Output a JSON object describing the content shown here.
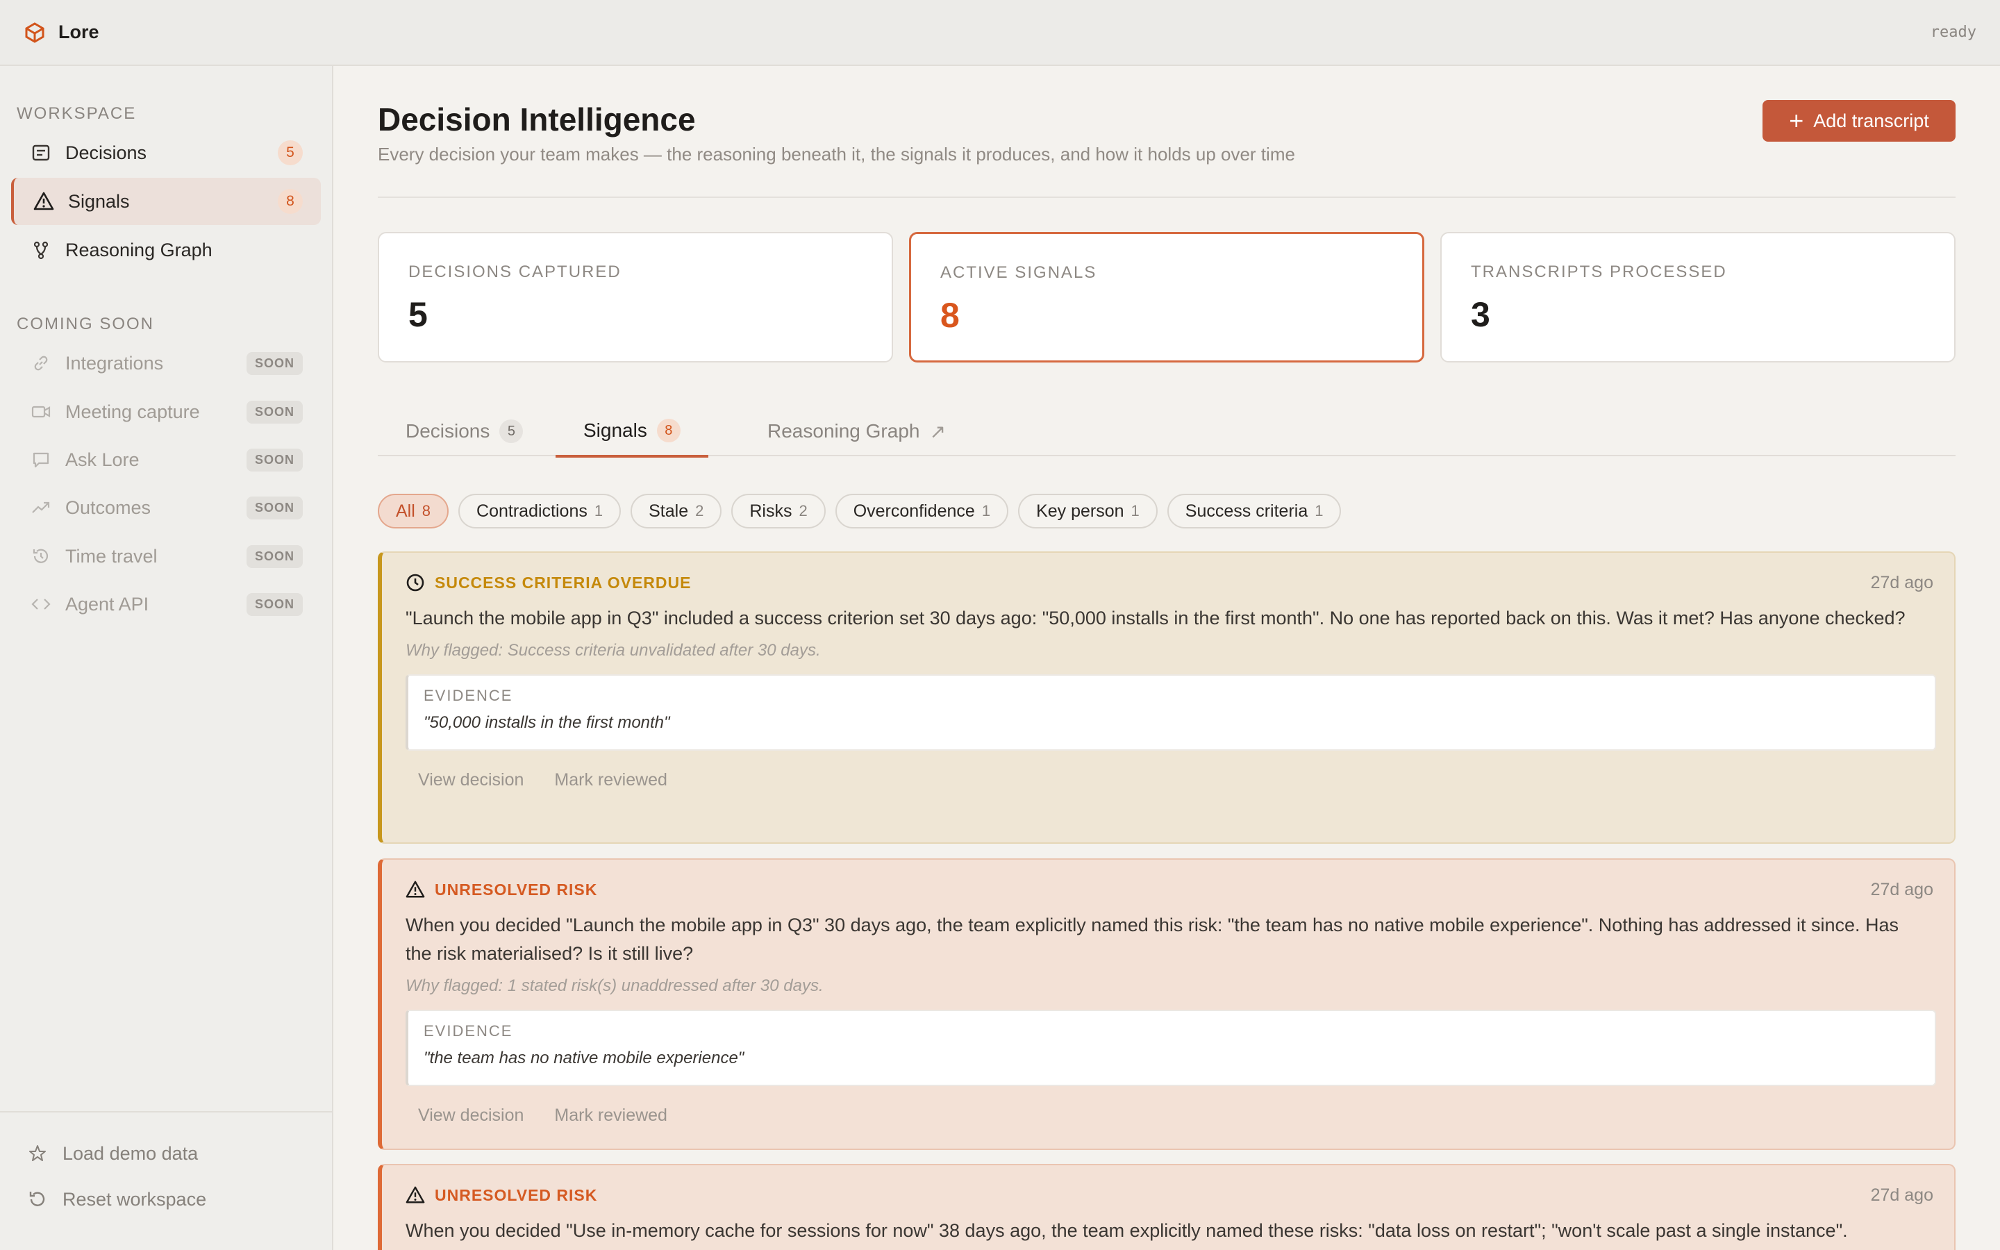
{
  "app": {
    "name": "Lore",
    "status": "ready"
  },
  "sidebar": {
    "workspace_label": "WORKSPACE",
    "items": [
      {
        "label": "Decisions",
        "count": "5",
        "icon": "list-icon"
      },
      {
        "label": "Signals",
        "count": "8",
        "icon": "warning-icon"
      },
      {
        "label": "Reasoning Graph",
        "icon": "branch-icon"
      }
    ],
    "coming_soon_label": "COMING SOON",
    "soon_items": [
      {
        "label": "Integrations",
        "badge": "SOON",
        "icon": "link-icon"
      },
      {
        "label": "Meeting capture",
        "badge": "SOON",
        "icon": "video-icon"
      },
      {
        "label": "Ask Lore",
        "badge": "SOON",
        "icon": "chat-icon"
      },
      {
        "label": "Outcomes",
        "badge": "SOON",
        "icon": "trend-icon"
      },
      {
        "label": "Time travel",
        "badge": "SOON",
        "icon": "history-icon"
      },
      {
        "label": "Agent API",
        "badge": "SOON",
        "icon": "code-icon"
      }
    ],
    "footer": [
      {
        "label": "Load demo data",
        "icon": "star-icon"
      },
      {
        "label": "Reset workspace",
        "icon": "reset-icon"
      }
    ]
  },
  "main": {
    "title": "Decision Intelligence",
    "subtitle": "Every decision your team makes — the reasoning beneath it, the signals it produces, and how it holds up over time",
    "add_button": "Add transcript",
    "stats": [
      {
        "label": "DECISIONS CAPTURED",
        "value": "5"
      },
      {
        "label": "ACTIVE SIGNALS",
        "value": "8"
      },
      {
        "label": "TRANSCRIPTS PROCESSED",
        "value": "3"
      }
    ],
    "tabs": [
      {
        "label": "Decisions",
        "count": "5"
      },
      {
        "label": "Signals",
        "count": "8"
      },
      {
        "label": "Reasoning Graph",
        "ext": "↗"
      }
    ],
    "filters": [
      {
        "label": "All",
        "count": "8"
      },
      {
        "label": "Contradictions",
        "count": "1"
      },
      {
        "label": "Stale",
        "count": "2"
      },
      {
        "label": "Risks",
        "count": "2"
      },
      {
        "label": "Overconfidence",
        "count": "1"
      },
      {
        "label": "Key person",
        "count": "1"
      },
      {
        "label": "Success criteria",
        "count": "1"
      }
    ],
    "signals": [
      {
        "type": "SUCCESS CRITERIA OVERDUE",
        "time": "27d ago",
        "text": "\"Launch the mobile app in Q3\" included a success criterion set 30 days ago: \"50,000 installs in the first month\". No one has reported back on this. Was it met? Has anyone checked?",
        "why": "Why flagged: Success criteria unvalidated after 30 days.",
        "evidence_label": "EVIDENCE",
        "evidence": "\"50,000 installs in the first month\"",
        "action_view": "View decision",
        "action_review": "Mark reviewed"
      },
      {
        "type": "UNRESOLVED RISK",
        "time": "27d ago",
        "text": "When you decided \"Launch the mobile app in Q3\" 30 days ago, the team explicitly named this risk: \"the team has no native mobile experience\". Nothing has addressed it since. Has the risk materialised? Is it still live?",
        "why": "Why flagged: 1 stated risk(s) unaddressed after 30 days.",
        "evidence_label": "EVIDENCE",
        "evidence": "\"the team has no native mobile experience\"",
        "action_view": "View decision",
        "action_review": "Mark reviewed"
      },
      {
        "type": "UNRESOLVED RISK",
        "time": "27d ago",
        "text": "When you decided \"Use in-memory cache for sessions for now\" 38 days ago, the team explicitly named these risks: \"data loss on restart\"; \"won't scale past a single instance\"."
      }
    ]
  },
  "colors": {
    "accent": "#c4583a",
    "signal_orange": "#d9561d",
    "amber": "#c7971d"
  }
}
